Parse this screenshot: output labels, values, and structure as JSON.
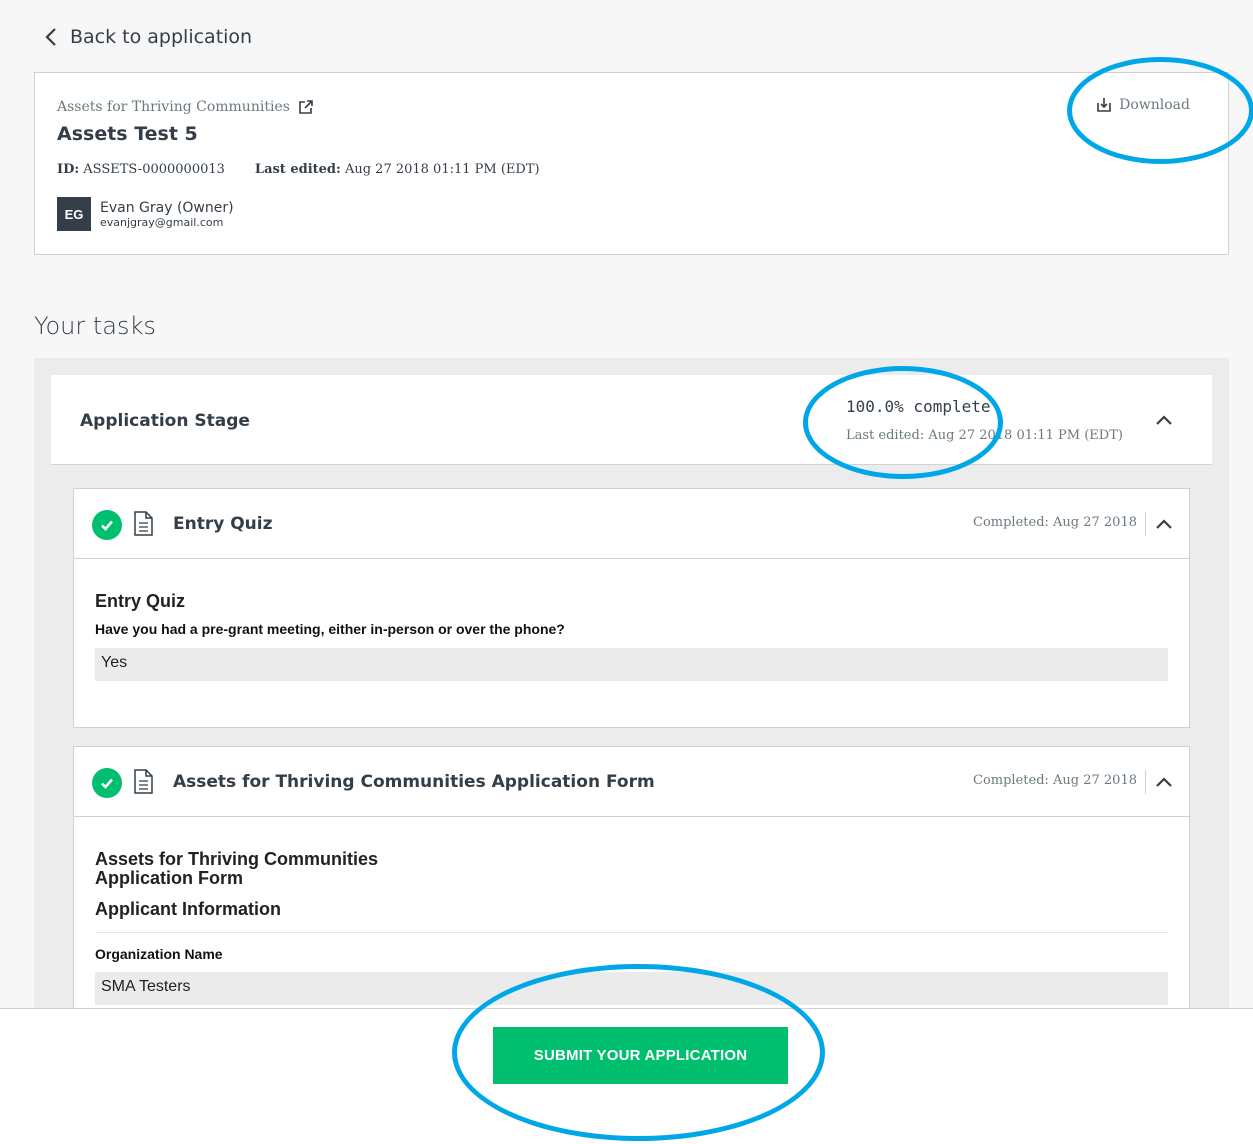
{
  "nav": {
    "back_label": "Back to application"
  },
  "header": {
    "program_name": "Assets for Thriving Communities",
    "title": "Assets Test 5",
    "id_label": "ID:",
    "id_value": "ASSETS-0000000013",
    "edited_label": "Last edited:",
    "edited_value": "Aug 27 2018 01:11 PM (EDT)",
    "owner": {
      "initials": "EG",
      "name": "Evan Gray (Owner)",
      "email": "evanjgray@gmail.com"
    },
    "download_label": "Download"
  },
  "tasks": {
    "heading": "Your tasks",
    "stage": {
      "title": "Application Stage",
      "progress": "100.0% complete",
      "last_edited": "Last edited: Aug 27 2018 01:11 PM (EDT)"
    },
    "items": [
      {
        "name": "Entry Quiz",
        "completed": "Completed: Aug 27 2018",
        "form_title": "Entry Quiz",
        "question": "Have you had a pre-grant meeting, either in-person or over the phone?",
        "answer": "Yes"
      },
      {
        "name": "Assets for Thriving Communities Application Form",
        "completed": "Completed: Aug 27 2018",
        "form_title_line1": "Assets for Thriving Communities",
        "form_title_line2": "Application Form",
        "section": "Applicant Information",
        "question": "Organization Name",
        "answer": "SMA Testers"
      }
    ]
  },
  "footer": {
    "submit_label": "SUBMIT YOUR APPLICATION"
  },
  "colors": {
    "accent_green": "#00bf6f",
    "annotation_blue": "#00a7e8",
    "text_dark": "#333e48"
  }
}
